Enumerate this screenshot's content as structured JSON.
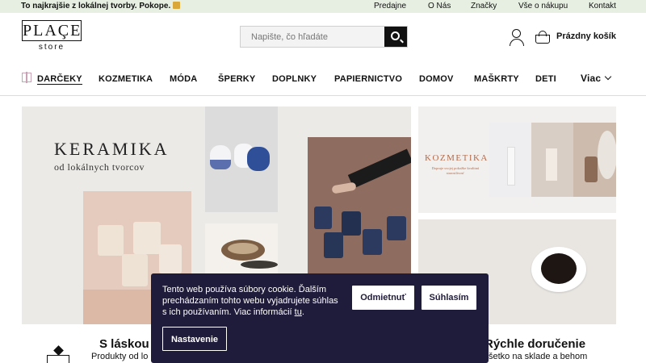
{
  "topbar": {
    "promo": "To najkrajšie z lokálnej tvorby. Pokope.",
    "links": [
      "Predajne",
      "O Nás",
      "Značky",
      "Vše o nákupu",
      "Kontakt"
    ]
  },
  "logo": {
    "word": "PLAÇE",
    "sub": "store"
  },
  "search": {
    "placeholder": "Napište, čo hľadáte",
    "button_icon": "search-icon"
  },
  "header": {
    "cart_label": "Prázdny košík"
  },
  "nav": {
    "items": [
      "DARČEKY",
      "KOZMETIKA",
      "MÓDA",
      "ŠPERKY",
      "DOPLNKY",
      "PAPIERNICTVO",
      "DOMOV",
      "MAŠKRTY",
      "DETI"
    ],
    "more": "Viac"
  },
  "hero": {
    "title": "KERAMIKA",
    "subtitle": "od lokálnych tvorcov"
  },
  "promo_cosmetics": {
    "title": "KOZMETIKA",
    "subtitle": "Dopraje svojej pokožke kvalitnú starostlivosť"
  },
  "features": [
    {
      "title": "S láskou",
      "desc": "Produkty od lo"
    },
    {
      "title": "Rýchle doručenie",
      "desc": "šetko na sklade a behom"
    }
  ],
  "cookie": {
    "text_main": "Tento web používa súbory cookie. Ďalším prechádzaním tohto webu vyjadrujete súhlas s ich používaním. Viac informácií ",
    "link": "tu",
    "text_end": ".",
    "reject": "Odmietnuť",
    "accept": "Súhlasím",
    "settings": "Nastavenie"
  },
  "colors": {
    "topbar": "#e6efe2",
    "cookie_bg": "#1f1b3a",
    "accent_pink": "#c9a2b3",
    "kozmetika_text": "#b26b4a"
  }
}
